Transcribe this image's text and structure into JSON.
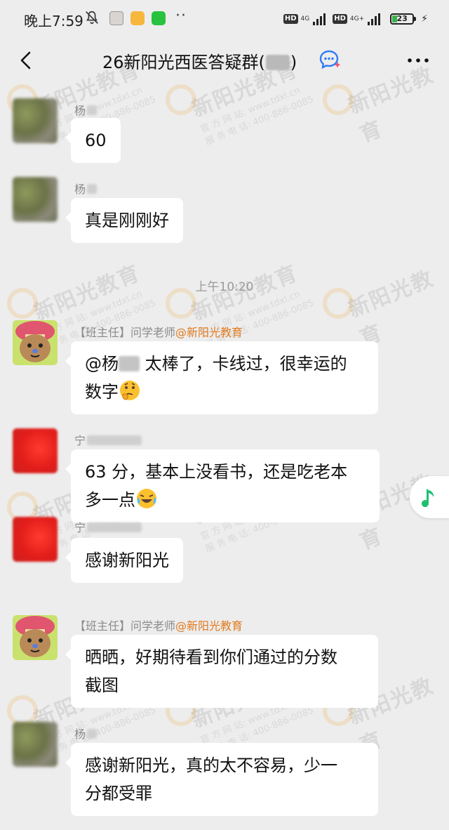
{
  "status_bar": {
    "time": "晚上7:59",
    "hd1": "HD",
    "net1": "4G",
    "hd2": "HD",
    "net2": "4G+",
    "battery": "23"
  },
  "nav": {
    "title_prefix": "26新阳光西医答疑群(",
    "title_suffix": ")"
  },
  "watermark": {
    "brand": "新阳光教育",
    "site": "官 方 网 站: www.tdxl.cn",
    "phone": "服 务 电 话: 400-886-0085"
  },
  "timestamp": "上午10:20",
  "messages": [
    {
      "sender": "杨",
      "text": "60"
    },
    {
      "sender": "杨",
      "text": "真是刚刚好"
    },
    {
      "sender_role": "【班主任】问学老师",
      "sender_org": "@新阳光教育",
      "mention": "@杨",
      "text_line1": " 太棒了，卡线过，很幸运的",
      "text_line2": "数字"
    },
    {
      "sender": "宁",
      "text_line1": "63 分，基本上没看书，还是吃老本",
      "text_line2": "多一点"
    },
    {
      "sender": "宁",
      "text": "感谢新阳光"
    },
    {
      "sender_role": "【班主任】问学老师",
      "sender_org": "@新阳光教育",
      "text_line1": "晒晒，好期待看到你们通过的分数",
      "text_line2": "截图"
    },
    {
      "sender": "杨",
      "text_line1": "感谢新阳光，真的太不容易，少一",
      "text_line2": "分都受罪"
    }
  ]
}
